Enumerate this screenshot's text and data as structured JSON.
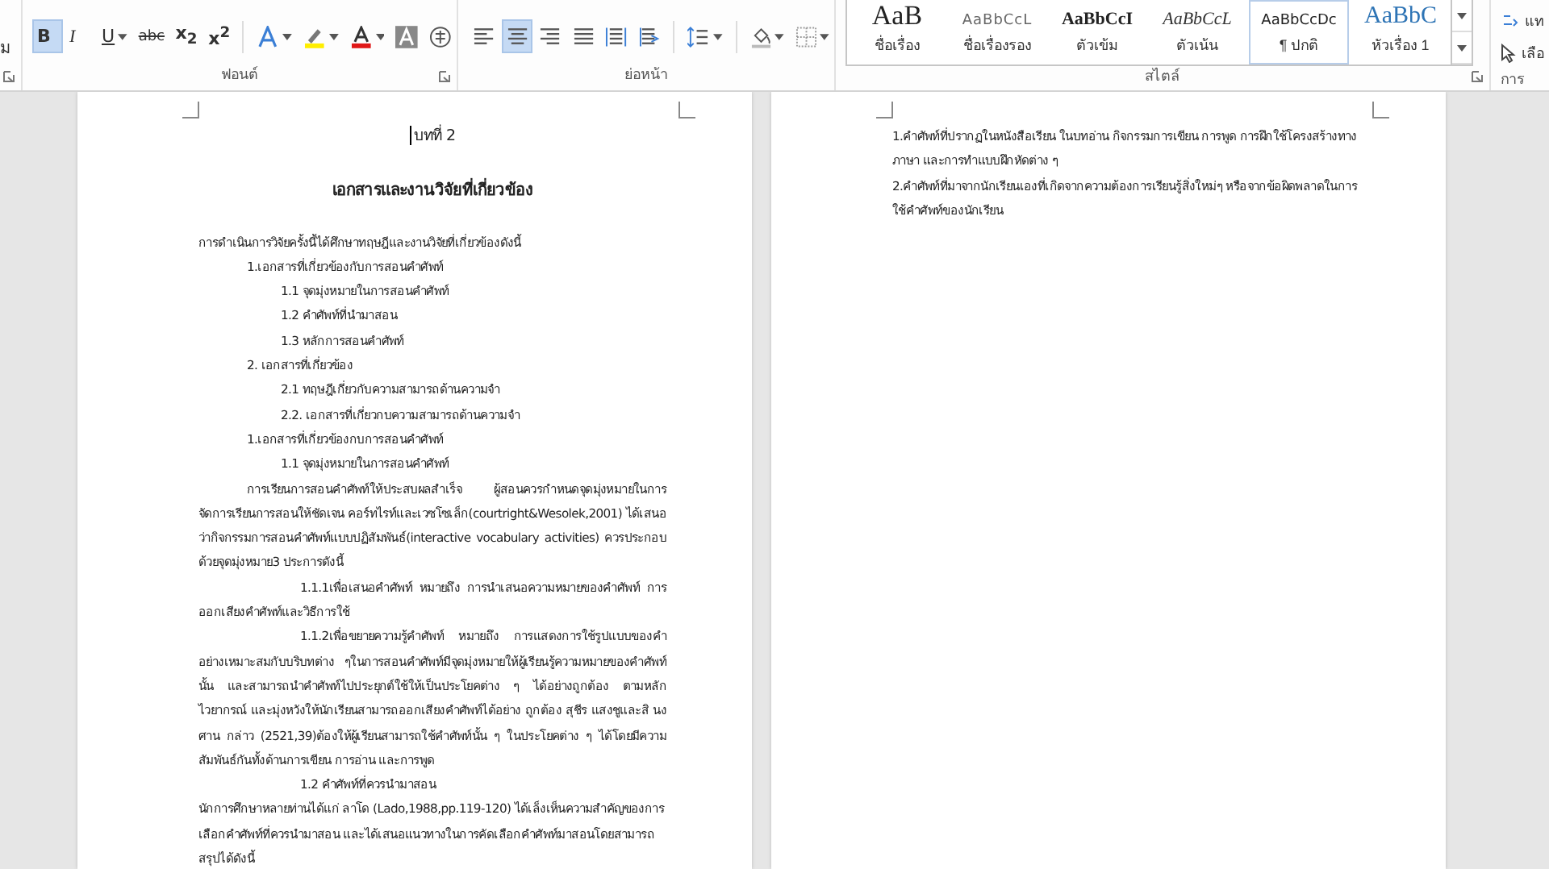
{
  "ribbon": {
    "clipboard_fragment": "ม",
    "font_group": {
      "label": "ฟอนต์",
      "buttons": [
        {
          "kind": "bold",
          "label": "B",
          "selected": true,
          "dropdown": false
        },
        {
          "kind": "italic",
          "label": "I",
          "selected": false,
          "dropdown": false
        },
        {
          "kind": "underline",
          "label": "U",
          "selected": false,
          "dropdown": true
        },
        {
          "kind": "strike",
          "label": "abc",
          "selected": false,
          "dropdown": false
        },
        {
          "kind": "subscript",
          "label": "x$_{2}$",
          "selected": false,
          "dropdown": false
        },
        {
          "kind": "superscript",
          "label": "x$^{2}$",
          "selected": false,
          "dropdown": false
        },
        {
          "kind": "text-effects",
          "selected": false,
          "dropdown": true
        },
        {
          "kind": "highlight",
          "selected": false,
          "dropdown": true
        },
        {
          "kind": "font-color",
          "selected": false,
          "dropdown": true
        },
        {
          "kind": "char-shading",
          "selected": false,
          "dropdown": false
        },
        {
          "kind": "enclose",
          "selected": false,
          "dropdown": false
        }
      ]
    },
    "paragraph_group": {
      "label": "ย่อหน้า",
      "buttons": [
        {
          "kind": "align-left",
          "selected": false,
          "dropdown": false
        },
        {
          "kind": "align-center",
          "selected": true,
          "dropdown": false
        },
        {
          "kind": "align-right",
          "selected": false,
          "dropdown": false
        },
        {
          "kind": "justify",
          "selected": false,
          "dropdown": false
        },
        {
          "kind": "distributed",
          "selected": false,
          "dropdown": false
        },
        {
          "kind": "thai-distributed",
          "selected": false,
          "dropdown": false
        },
        {
          "kind": "line-spacing",
          "selected": false,
          "dropdown": true
        },
        {
          "kind": "shading",
          "selected": false,
          "dropdown": true
        },
        {
          "kind": "borders",
          "selected": false,
          "dropdown": true
        }
      ]
    },
    "styles_group": {
      "label": "สไตล์",
      "styles": [
        {
          "kind": "title",
          "preview": "AaB",
          "name": "ชื่อเรื่อง",
          "selected": false
        },
        {
          "kind": "subtitle",
          "preview": "AaBbCcL",
          "name": "ชื่อเรื่องรอง",
          "selected": false
        },
        {
          "kind": "strong",
          "preview": "AaBbCcI",
          "name": "ตัวเข้ม",
          "selected": false
        },
        {
          "kind": "emphasis",
          "preview": "AaBbCcL",
          "name": "ตัวเน้น",
          "selected": false
        },
        {
          "kind": "normal",
          "preview": "AaBbCcDc",
          "name": "¶ ปกติ",
          "selected": true
        },
        {
          "kind": "heading",
          "preview": "AaBbC",
          "name": "หัวเรื่อง 1",
          "selected": false
        }
      ]
    },
    "editing_group": {
      "label": "การ",
      "items": [
        {
          "kind": "replace",
          "label": "แท"
        },
        {
          "kind": "select",
          "label": "เลือ"
        }
      ]
    }
  },
  "pages": [
    {
      "paragraphs": [
        {
          "kind": "chapter",
          "text": "บทที่ 2",
          "cursor": true
        },
        {
          "kind": "heading",
          "text": "เอกสารและงานวิจัยที่เกี่ยวข้อง",
          "cursor": false
        },
        {
          "kind": "para",
          "text": "การดำเนินการวิจัยครั้งนี้ได้ศึกษาทฤษฎีและงานวิจัยที่เกี่ยวข้องดังนี้",
          "cursor": false
        },
        {
          "kind": "level1",
          "text": "1.เอกสารที่เกี่ยวข้องกับการสอนคำศัพท์",
          "cursor": false
        },
        {
          "kind": "level2",
          "text": "1.1 จุดมุ่งหมายในการสอนคำศัพท์",
          "cursor": false
        },
        {
          "kind": "level2",
          "text": "1.2 คำศัพท์ที่นำมาสอน",
          "cursor": false
        },
        {
          "kind": "level2",
          "text": "1.3 หลักการสอนคำศัพท์",
          "cursor": false
        },
        {
          "kind": "level1",
          "text": "2. เอกสารที่เกี่ยวข้อง",
          "cursor": false
        },
        {
          "kind": "level2",
          "text": "2.1 ทฤษฎีเกี่ยวกับความสามารถด้านความจำ",
          "cursor": false
        },
        {
          "kind": "level2",
          "text": "2.2. เอกสารที่เกี่ยวกบความสามารถด้านความจำ",
          "cursor": false
        },
        {
          "kind": "level1",
          "text": "1.เอกสารที่เกี่ยวข้องกบการสอนคำศัพท์",
          "cursor": false
        },
        {
          "kind": "level2",
          "text": "1.1 จุดมุ่งหมายในการสอนคำศัพท์",
          "cursor": false
        },
        {
          "kind": "indented",
          "text": "การเรียนการสอนคำศัพท์ให้ประสบผลสำเร็จ ผู้สอนควรกำหนดจุดมุ่งหมายในการจัดการเรียนการสอนให้ชัดเจน คอร์ทไรท์และเวซโซเล็ก(courtright&Wesolek,2001) ได้เสนอว่ากิจกรรมการสอนคำศัพท์แบบปฏิสัมพันธ์(interactive vocabulary activities) ควรประกอบด้วยจุดมุ่งหมาย3 ประการดังนี้",
          "cursor": false
        },
        {
          "kind": "deep",
          "text": "1.1.1เพื่อเสนอคำศัพท์ หมายถึง การนำเสนอความหมายของคำศัพท์ การออกเสียงคำศัพท์และวิธีการใช้",
          "cursor": false
        },
        {
          "kind": "deep",
          "text": "1.1.2เพื่อขยายความรู้คำศัพท์ หมายถึง การแสดงการใช้รูปแบบของคำอย่างเหมาะสมกับบริบทต่าง ๆในการสอนคำศัพท์มีจุดมุ่งหมายให้ผู้เรียนรู้ความหมายของคำศัพท์นั้น และสามารถนำคำศัพท์ไปประยุกต์ใช้ให้เป็นประโยคต่าง ๆ ได้อย่างถูกต้อง ตามหลักไวยากรณ์ และมุ่งหวังให้นักเรียนสามารถออกเสียงคำศัพท์ได้อย่าง ถูกต้อง สุชีร แสงชูและสิ นงศาน กล่าว (2521,39)ต้องให้ผู้เรียนสามารถใช้คำศัพท์นั้น ๆ ในประโยคต่าง ๆ ได้โดยมีความสัมพันธ์กันทั้งด้านการเขียน การอ่าน และการพูด",
          "cursor": false
        },
        {
          "kind": "sub",
          "text": "1.2 คำศัพท์ที่ควรนำมาสอน",
          "cursor": false
        },
        {
          "kind": "para",
          "text": "นักการศึกษาหลายท่านได้แก่ ลาโด (Lado,1988,pp.119-120) ได้เล็งเห็นความสำคัญของการเลือกคำศัพท์ที่ควรนำมาสอน และได้เสนอแนวทางในการคัดเลือกคำศัพท์มาสอนโดยสามารถสรุปได้ดังนี้",
          "cursor": false
        }
      ]
    },
    {
      "paragraphs": [
        {
          "kind": "para",
          "text": "1.คำศัพท์ที่ปรากฏในหนังสือเรียน ในบทอ่าน กิจกรรมการเขียน การพูด การฝึกใช้โครงสร้างทางภาษา และการทำแบบฝึกหัดต่าง ๆ",
          "cursor": false
        },
        {
          "kind": "para",
          "text": " 2.คำศัพท์ที่มาจากนักเรียนเองที่เกิดจากความต้องการเรียนรู้สิ่งใหม่ๆ หรือจากข้อผิดพลาดในการใช้คำศัพท์ของนักเรียน",
          "cursor": false
        }
      ]
    }
  ]
}
